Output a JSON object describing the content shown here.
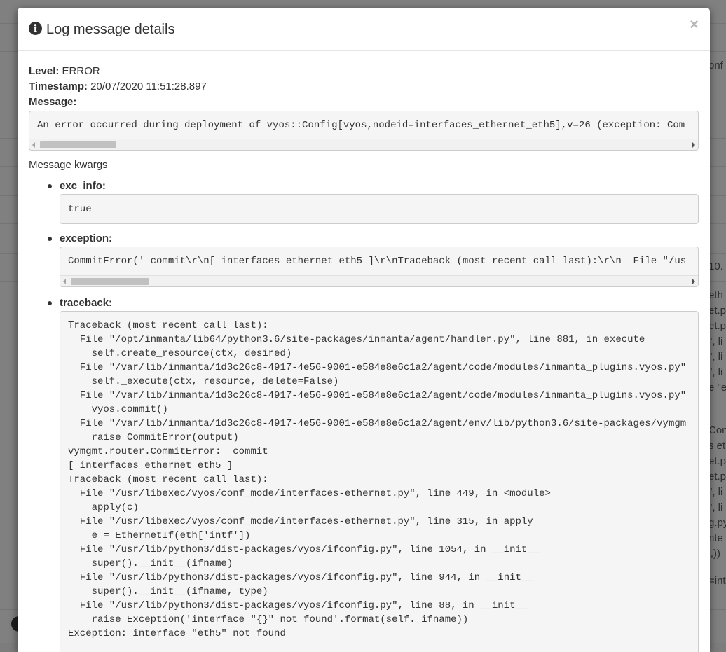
{
  "background": {
    "fragments": [
      "onf",
      "10.",
      "eth",
      "et.p",
      "et.p",
      "\", li",
      "\", li",
      "\", li",
      "e \"e",
      "Con",
      "s et",
      "et.p",
      "et.p",
      "\", li",
      "\", li",
      "g.py",
      "nte",
      "',))",
      "=int"
    ]
  },
  "modal": {
    "icon": "info-circle-icon",
    "title": "Log message details",
    "close_label": "×",
    "level_label": "Level:",
    "level_value": "ERROR",
    "timestamp_label": "Timestamp:",
    "timestamp_value": "20/07/2020 11:51:28.897",
    "message_label": "Message:",
    "message_value": "An error occurred during deployment of vyos::Config[vyos,nodeid=interfaces_ethernet_eth5],v=26 (exception: Com",
    "kwargs_title": "Message kwargs",
    "kwargs": [
      {
        "key": "exc_info:",
        "value": "true"
      },
      {
        "key": "exception:",
        "value": "CommitError(' commit\\r\\n[ interfaces ethernet eth5 ]\\r\\nTraceback (most recent call last):\\r\\n  File \"/us"
      },
      {
        "key": "traceback:",
        "lines": [
          "Traceback (most recent call last):",
          "  File \"/opt/inmanta/lib64/python3.6/site-packages/inmanta/agent/handler.py\", line 881, in execute",
          "    self.create_resource(ctx, desired)",
          "  File \"/var/lib/inmanta/1d3c26c8-4917-4e56-9001-e584e8e6c1a2/agent/code/modules/inmanta_plugins.vyos.py\"",
          "    self._execute(ctx, resource, delete=False)",
          "  File \"/var/lib/inmanta/1d3c26c8-4917-4e56-9001-e584e8e6c1a2/agent/code/modules/inmanta_plugins.vyos.py\"",
          "    vyos.commit()",
          "  File \"/var/lib/inmanta/1d3c26c8-4917-4e56-9001-e584e8e6c1a2/agent/env/lib/python3.6/site-packages/vymgm",
          "    raise CommitError(output)",
          "vymgmt.router.CommitError:  commit",
          "[ interfaces ethernet eth5 ]",
          "Traceback (most recent call last):",
          "  File \"/usr/libexec/vyos/conf_mode/interfaces-ethernet.py\", line 449, in <module>",
          "    apply(c)",
          "  File \"/usr/libexec/vyos/conf_mode/interfaces-ethernet.py\", line 315, in apply",
          "    e = EthernetIf(eth['intf'])",
          "  File \"/usr/lib/python3/dist-packages/vyos/ifconfig.py\", line 1054, in __init__",
          "    super().__init__(ifname)",
          "  File \"/usr/lib/python3/dist-packages/vyos/ifconfig.py\", line 944, in __init__",
          "    super().__init__(ifname, type)",
          "  File \"/usr/lib/python3/dist-packages/vyos/ifconfig.py\", line 88, in __init__",
          "    raise Exception('interface \"{}\" not found'.format(self._ifname))",
          "Exception: interface \"eth5\" not found"
        ]
      }
    ]
  }
}
